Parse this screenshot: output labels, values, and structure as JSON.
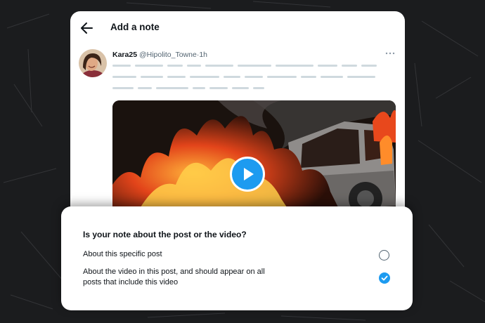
{
  "header": {
    "title": "Add a note",
    "back_icon": "arrow-left-icon"
  },
  "post": {
    "author_name": "Kara25",
    "handle": "@Hipolito_Towne",
    "separator": "·",
    "time": "1h",
    "more_icon": "more-horizontal-icon",
    "media": {
      "type": "video",
      "play_icon": "play-icon"
    }
  },
  "prompt": {
    "question": "Is your note about the post or the video?",
    "options": [
      {
        "label": "About this specific post",
        "selected": false
      },
      {
        "label": "About the video in this post, and should appear on all posts that include this video",
        "selected": true
      }
    ]
  },
  "colors": {
    "accent": "#1d9bf0",
    "background": "#1b1c1e",
    "placeholder_text": "#cfd9de"
  }
}
